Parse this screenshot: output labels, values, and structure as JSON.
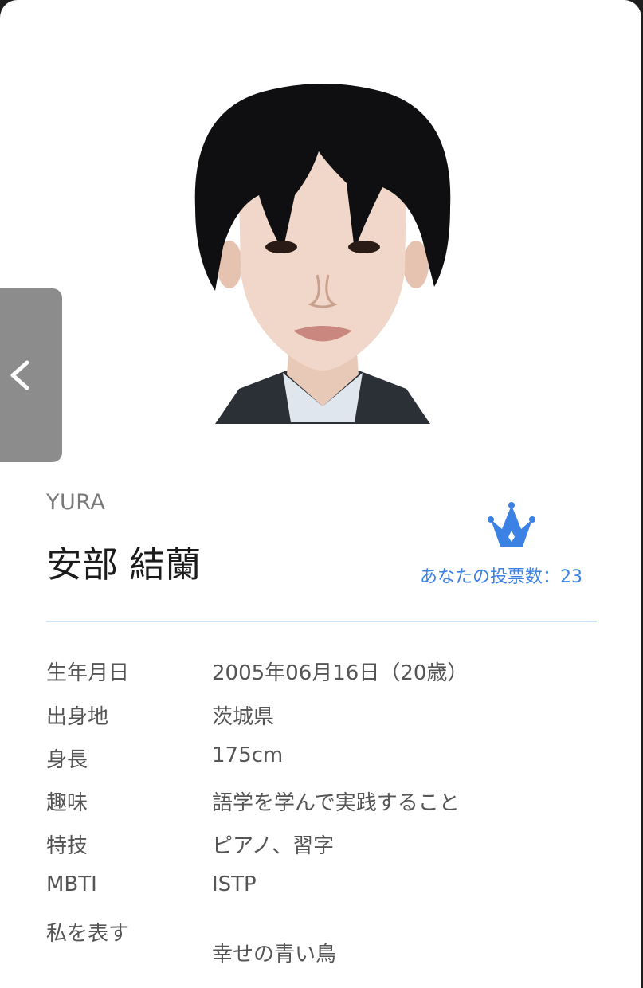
{
  "nav": {
    "back_icon": "chevron-left-icon"
  },
  "profile": {
    "romaji": "YURA",
    "name": "安部 結蘭",
    "vote_icon": "crown-icon",
    "vote_text": "あなたの投票数：23"
  },
  "details": [
    {
      "label": "生年月日",
      "value": "2005年06月16日（20歳）"
    },
    {
      "label": "出身地",
      "value": "茨城県"
    },
    {
      "label": "身長",
      "value": "175cm"
    },
    {
      "label": "趣味",
      "value": "語学を学んで実践すること"
    },
    {
      "label": "特技",
      "value": "ピアノ、習字"
    },
    {
      "label": "MBTI",
      "value": "ISTP"
    },
    {
      "label": "私を表す",
      "value": "幸せの青い鳥"
    }
  ],
  "colors": {
    "accent": "#3b82e4",
    "divider": "#cfe3f4",
    "back_tab": "#8c8c8c"
  }
}
